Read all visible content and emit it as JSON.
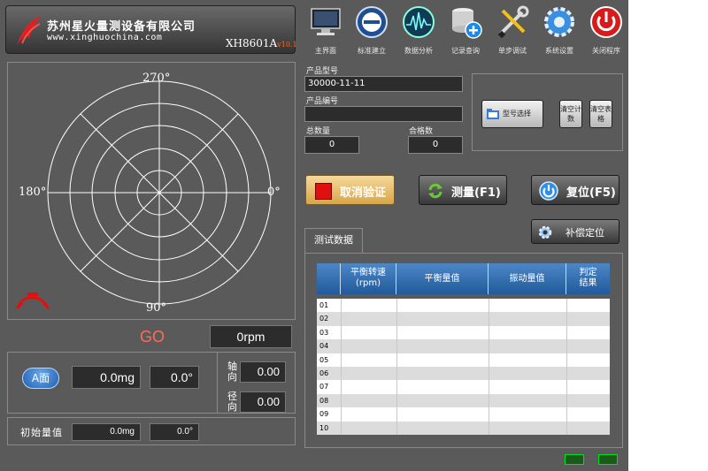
{
  "header": {
    "company_name": "苏州星火量测设备有限公司",
    "website": "www.xinghuochina.com",
    "model": "XH8601A",
    "version": "v10.1"
  },
  "toolbar": [
    {
      "label": "主界面",
      "icon": "monitor-icon"
    },
    {
      "label": "标准建立",
      "icon": "calibration-icon"
    },
    {
      "label": "数据分析",
      "icon": "waveform-icon"
    },
    {
      "label": "记录查询",
      "icon": "database-icon"
    },
    {
      "label": "单步调试",
      "icon": "tools-icon"
    },
    {
      "label": "系统设置",
      "icon": "gear-icon"
    },
    {
      "label": "关闭程序",
      "icon": "power-icon"
    }
  ],
  "polar": {
    "labels": {
      "top": "270°",
      "left": "180°",
      "right": "0°",
      "bottom": "90°"
    }
  },
  "status": {
    "result": "GO",
    "speed": "0rpm"
  },
  "measurement": {
    "face_label": "A面",
    "amount": "0.0mg",
    "angle": "0.0°",
    "axial_label": "轴向",
    "axial_value": "0.00",
    "radial_label": "径向",
    "radial_value": "0.00"
  },
  "initial": {
    "label": "初始量值",
    "amount": "0.0mg",
    "angle": "0.0°"
  },
  "product": {
    "model_label": "产品型号",
    "model_value": "30000-11-11",
    "serial_label": "产品编号",
    "serial_value": "",
    "total_label": "总数量",
    "total_value": "0",
    "pass_label": "合格数",
    "pass_value": "0"
  },
  "config_buttons": {
    "model_select": "型号选择",
    "clear_count": "清空计数",
    "clear_table": "清空表格"
  },
  "actions": {
    "cancel_verify": "取消验证",
    "measure": "测量(F1)",
    "reset": "复位(F5)",
    "compensate": "补偿定位"
  },
  "tab": {
    "label": "测试数据"
  },
  "table": {
    "headers": [
      "平衡转速\n(rpm)",
      "平衡量值",
      "振动量值",
      "判定\n结果"
    ],
    "rows": [
      "01",
      "02",
      "03",
      "04",
      "05",
      "06",
      "07",
      "08",
      "09",
      "10"
    ]
  },
  "colors": {
    "background": "#5a5a5a",
    "table_header": "#2f6db0",
    "go": "#ff6b5b",
    "stop_red": "#e01010"
  }
}
